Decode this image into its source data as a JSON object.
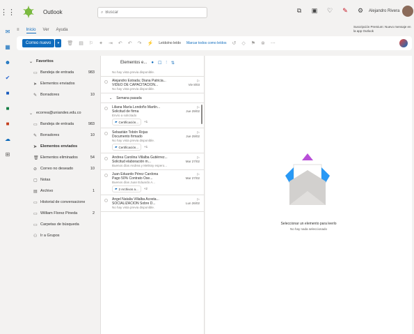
{
  "topbar": {
    "app_name": "Outlook",
    "search_placeholder": "Buscar",
    "user_name": "Alejandro Rivera"
  },
  "tabs": [
    {
      "label": "Inicio"
    },
    {
      "label": "Ver"
    },
    {
      "label": "Ayuda"
    }
  ],
  "notice": "Suscripción Premium: Nuevo mensaje en la app Outlook",
  "ribbon": {
    "new_mail": "Correo nuevo",
    "read_unread": "Leído/no leído",
    "mark_all": "Marcar todos como leídos"
  },
  "folders": {
    "favorites_header": "Favoritos",
    "favorites": [
      {
        "label": "Bandeja de entrada",
        "count": "983",
        "icon": "inbox-icon"
      },
      {
        "label": "Elementos enviados",
        "count": "",
        "icon": "send-icon"
      },
      {
        "label": "Borradores",
        "count": "10",
        "icon": "draft-icon"
      }
    ],
    "account": "ecorrea@uniandes.edu.co",
    "account_folders": [
      {
        "label": "Bandeja de entrada",
        "count": "983",
        "icon": "inbox-icon"
      },
      {
        "label": "Borradores",
        "count": "10",
        "icon": "draft-icon"
      },
      {
        "label": "Elementos enviados",
        "count": "",
        "icon": "send-icon"
      },
      {
        "label": "Elementos eliminados",
        "count": "54",
        "icon": "trash-icon"
      },
      {
        "label": "Correo no deseado",
        "count": "10",
        "icon": "junk-icon"
      },
      {
        "label": "Notas",
        "count": "",
        "icon": "note-icon"
      },
      {
        "label": "Archivo",
        "count": "1",
        "icon": "archive-icon"
      },
      {
        "label": "Historial de conversaciones",
        "count": "",
        "icon": "folder-icon"
      },
      {
        "label": "William Florez Pineda",
        "count": "2",
        "icon": "folder-icon"
      },
      {
        "label": "Carpetas de búsqueda",
        "count": "",
        "icon": "search-folder-icon"
      },
      {
        "label": "Ir a Grupos",
        "count": "",
        "icon": "groups-icon"
      }
    ]
  },
  "list": {
    "header": "Elementos e...",
    "top_preview": "No hay vista previa disponible.",
    "messages_top": [
      {
        "from": "Alejandro Estrada; Diana Patricia...",
        "subject": "VIDEO DE CAPACITACIÓN...",
        "date": "Vie 8/03",
        "preview": "No hay vista previa disponible."
      }
    ],
    "group_label": "Semana pasada",
    "messages": [
      {
        "from": "Liliana María Londoño Martín...",
        "subject": "Solicitud de firma",
        "date": "Jue 29/02",
        "preview": "Envío a solicitado",
        "attachment": "Certificación...",
        "more": "+1"
      },
      {
        "from": "Sebastián Tobón Rojas",
        "subject": "Documento firmado",
        "date": "Jue 29/02",
        "preview": "No hay vista previa disponible.",
        "attachment": "Certificación...",
        "more": "+1"
      },
      {
        "from": "Andrea Carolina Villalba Gutiérrez...",
        "subject": "Solicitud elaboración m...",
        "date": "Mar 27/02",
        "preview": "Buenos días Andrea y Melissy espero...",
        "attachment": "",
        "more": ""
      },
      {
        "from": "Juan Eduardo Pérez Cardona",
        "subject": "Pago 50% Contrato Ose...",
        "date": "Mar 27/02",
        "preview": "Buenos días Juan Eduardo A...",
        "attachment": "2 Archivos a...",
        "more": "+2"
      },
      {
        "from": "Ángel Natalia Villalba Acosta...",
        "subject": "SOCIALIZACIÓN Sobre D...",
        "date": "Lun 26/02",
        "preview": "No hay vista previa disponible.",
        "attachment": "",
        "more": ""
      }
    ]
  },
  "reading": {
    "empty_title": "Seleccionar un elemento para leerlo",
    "empty_sub": "No hay nada seleccionado"
  }
}
